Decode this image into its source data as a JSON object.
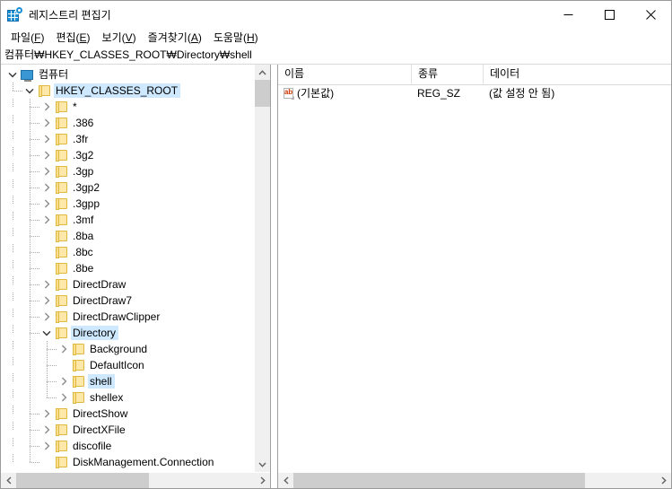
{
  "window": {
    "title": "레지스트리 편집기",
    "icon": "registry-editor-icon",
    "minimize_label": "−",
    "maximize_label": "□",
    "close_label": "✕"
  },
  "menubar": {
    "items": [
      {
        "label": "파일",
        "mnemonic": "F"
      },
      {
        "label": "편집",
        "mnemonic": "E"
      },
      {
        "label": "보기",
        "mnemonic": "V"
      },
      {
        "label": "즐겨찾기",
        "mnemonic": "A"
      },
      {
        "label": "도움말",
        "mnemonic": "H"
      }
    ]
  },
  "address": {
    "path": "컴퓨터\\HKEY_CLASSES_ROOT\\Directory\\shell",
    "display": "컴퓨터₩HKEY_CLASSES_ROOT₩Directory₩shell"
  },
  "tree": {
    "rows": [
      {
        "label": "컴퓨터",
        "depth": 0,
        "icon": "computer-icon",
        "state": "expanded",
        "selected": false
      },
      {
        "label": "HKEY_CLASSES_ROOT",
        "depth": 1,
        "icon": "folder-icon",
        "state": "expanded",
        "selected": true
      },
      {
        "label": "*",
        "depth": 2,
        "icon": "folder-icon",
        "state": "collapsed",
        "selected": false
      },
      {
        "label": ".386",
        "depth": 2,
        "icon": "folder-icon",
        "state": "collapsed",
        "selected": false
      },
      {
        "label": ".3fr",
        "depth": 2,
        "icon": "folder-icon",
        "state": "collapsed",
        "selected": false
      },
      {
        "label": ".3g2",
        "depth": 2,
        "icon": "folder-icon",
        "state": "collapsed",
        "selected": false
      },
      {
        "label": ".3gp",
        "depth": 2,
        "icon": "folder-icon",
        "state": "collapsed",
        "selected": false
      },
      {
        "label": ".3gp2",
        "depth": 2,
        "icon": "folder-icon",
        "state": "collapsed",
        "selected": false
      },
      {
        "label": ".3gpp",
        "depth": 2,
        "icon": "folder-icon",
        "state": "collapsed",
        "selected": false
      },
      {
        "label": ".3mf",
        "depth": 2,
        "icon": "folder-icon",
        "state": "collapsed",
        "selected": false
      },
      {
        "label": ".8ba",
        "depth": 2,
        "icon": "folder-icon",
        "state": "leaf",
        "selected": false
      },
      {
        "label": ".8bc",
        "depth": 2,
        "icon": "folder-icon",
        "state": "leaf",
        "selected": false
      },
      {
        "label": ".8be",
        "depth": 2,
        "icon": "folder-icon",
        "state": "leaf",
        "selected": false
      },
      {
        "label": "DirectDraw",
        "depth": 2,
        "icon": "folder-icon",
        "state": "collapsed",
        "selected": false
      },
      {
        "label": "DirectDraw7",
        "depth": 2,
        "icon": "folder-icon",
        "state": "collapsed",
        "selected": false
      },
      {
        "label": "DirectDrawClipper",
        "depth": 2,
        "icon": "folder-icon",
        "state": "collapsed",
        "selected": false
      },
      {
        "label": "Directory",
        "depth": 2,
        "icon": "folder-icon",
        "state": "expanded",
        "selected": true
      },
      {
        "label": "Background",
        "depth": 3,
        "icon": "folder-icon",
        "state": "collapsed",
        "selected": false
      },
      {
        "label": "DefaultIcon",
        "depth": 3,
        "icon": "folder-icon",
        "state": "leaf",
        "selected": false
      },
      {
        "label": "shell",
        "depth": 3,
        "icon": "folder-icon",
        "state": "collapsed",
        "selected": true
      },
      {
        "label": "shellex",
        "depth": 3,
        "icon": "folder-icon",
        "state": "collapsed",
        "selected": false
      },
      {
        "label": "DirectShow",
        "depth": 2,
        "icon": "folder-icon",
        "state": "collapsed",
        "selected": false
      },
      {
        "label": "DirectXFile",
        "depth": 2,
        "icon": "folder-icon",
        "state": "collapsed",
        "selected": false
      },
      {
        "label": "discofile",
        "depth": 2,
        "icon": "folder-icon",
        "state": "collapsed",
        "selected": false
      },
      {
        "label": "DiskManagement.Connection",
        "depth": 2,
        "icon": "folder-icon",
        "state": "leaf",
        "selected": false
      }
    ]
  },
  "list": {
    "columns": [
      {
        "label": "이름"
      },
      {
        "label": "종류"
      },
      {
        "label": "데이터"
      }
    ],
    "rows": [
      {
        "icon": "string-value-icon",
        "name": "(기본값)",
        "type": "REG_SZ",
        "data": "(값 설정 안 됨)"
      }
    ]
  },
  "colors": {
    "selection": "#cde8ff",
    "folder": "#fde8a9",
    "folder_border": "#dfb93f",
    "accent": "#1b8fd4",
    "scrollbar_thumb": "#cdcdcd",
    "scrollbar_track": "#f0f0f0"
  }
}
